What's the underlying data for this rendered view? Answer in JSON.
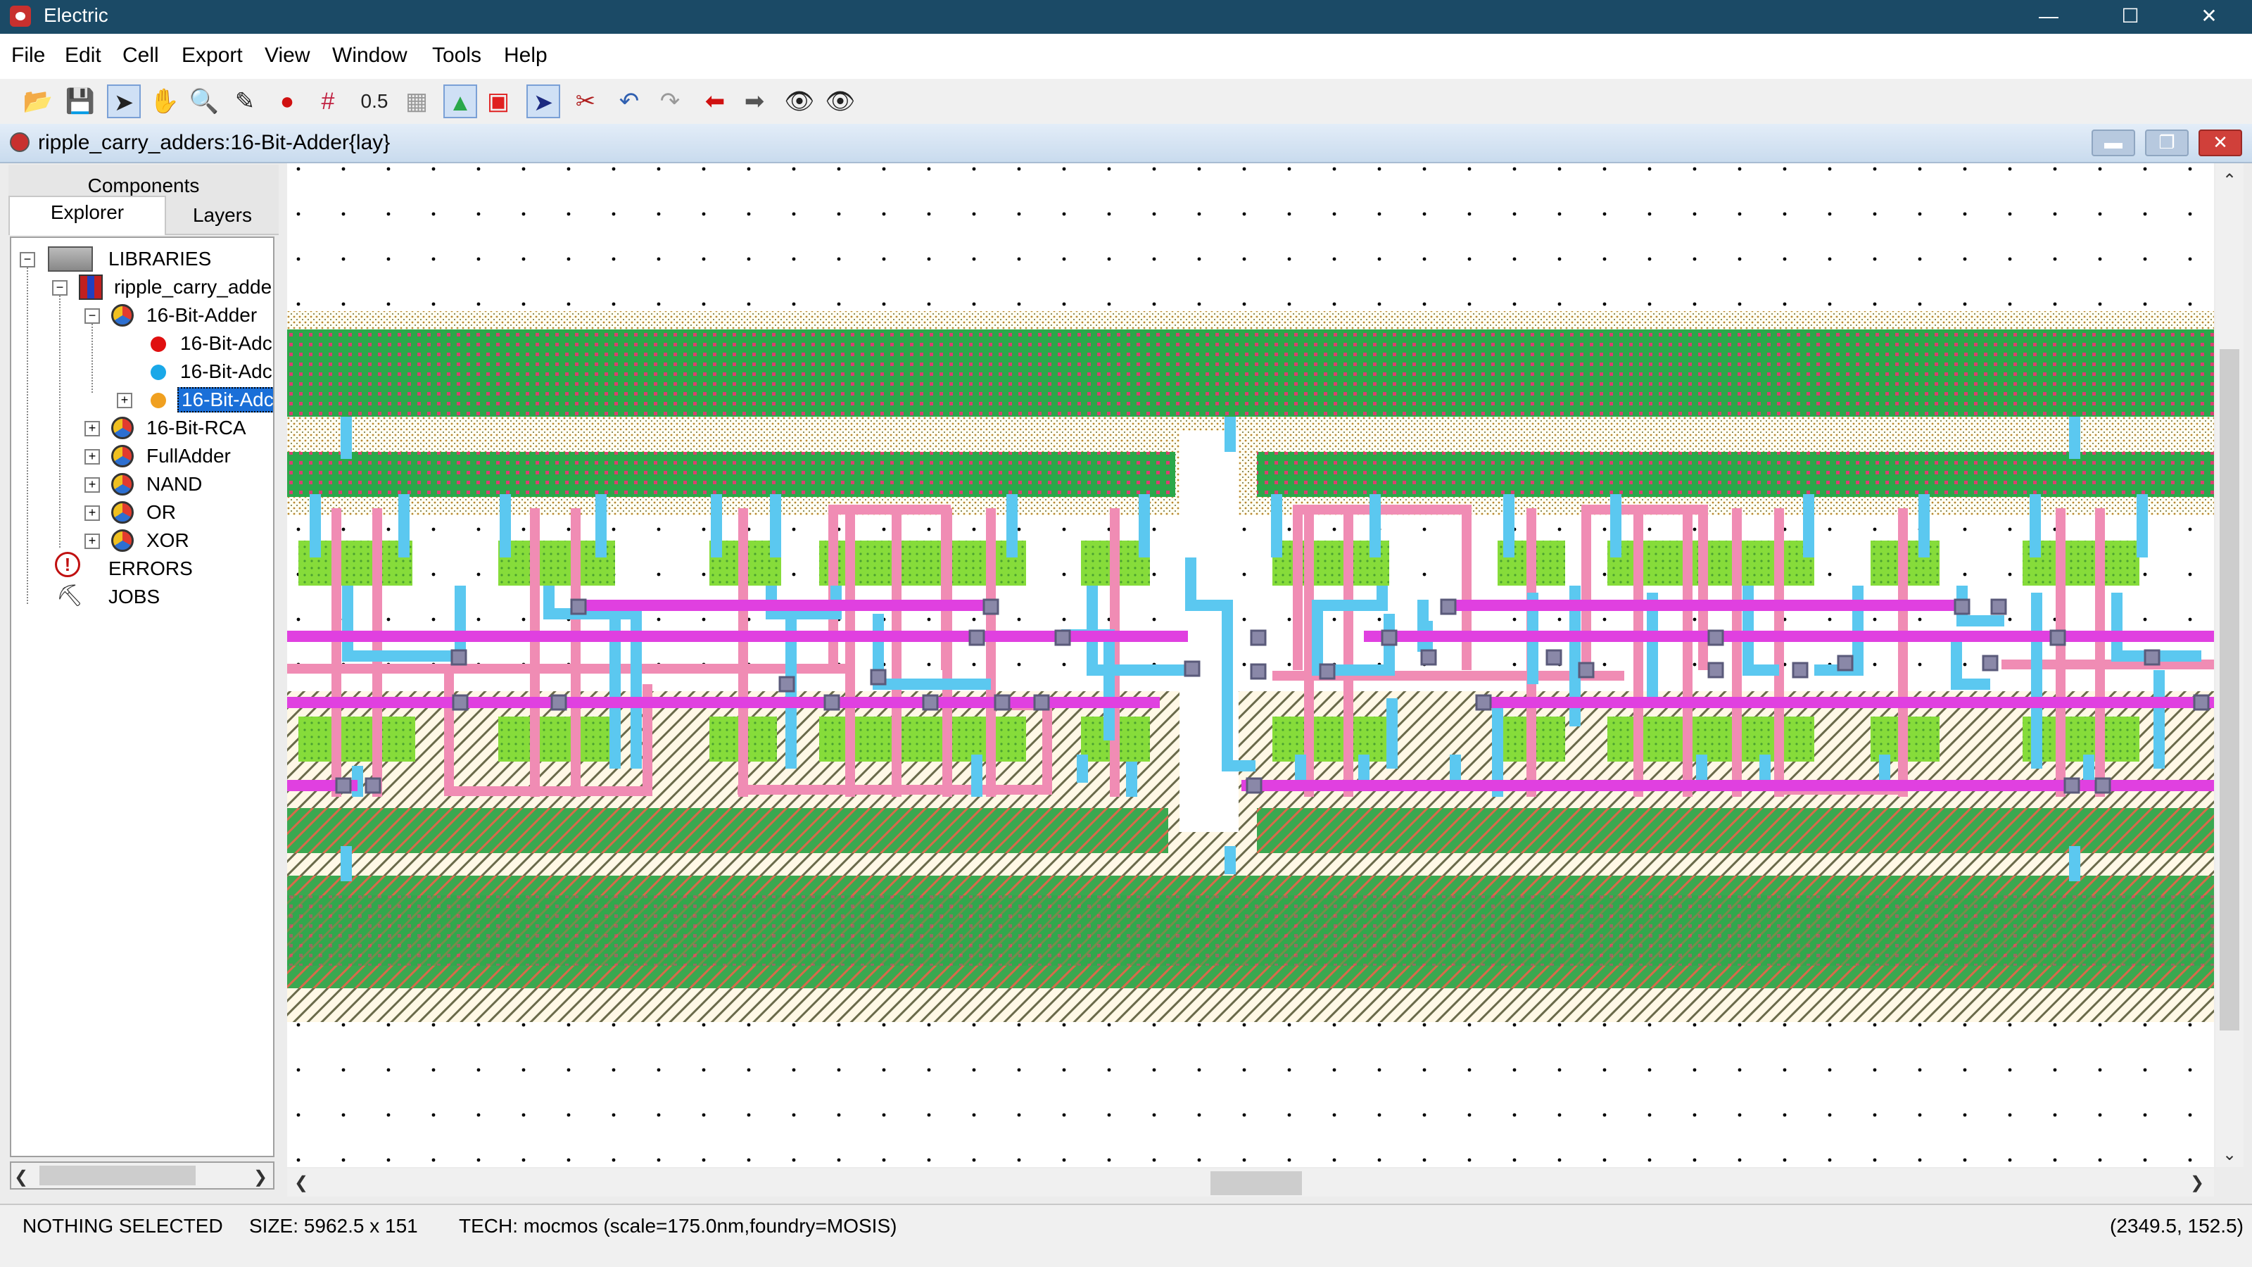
{
  "window": {
    "title": "Electric",
    "minimize_icon": "minimize-icon",
    "maximize_icon": "maximize-icon",
    "close_icon": "close-icon"
  },
  "menu": [
    "File",
    "Edit",
    "Cell",
    "Export",
    "View",
    "Window",
    "Tools",
    "Help"
  ],
  "toolbar": {
    "scale_label": "0.5"
  },
  "frame": {
    "title": "ripple_carry_adders:16-Bit-Adder{lay}"
  },
  "panel": {
    "tabs": {
      "components": "Components",
      "explorer": "Explorer",
      "layers": "Layers"
    },
    "tree": {
      "libraries": "LIBRARIES",
      "library": "ripple_carry_adde",
      "cell_open": "16-Bit-Adder",
      "views": [
        "16-Bit-Adc",
        "16-Bit-Adc",
        "16-Bit-Adc"
      ],
      "cells": [
        "16-Bit-RCA",
        "FullAdder",
        "NAND",
        "OR",
        "XOR"
      ],
      "errors": "ERRORS",
      "jobs": "JOBS"
    }
  },
  "status": {
    "selection": "NOTHING SELECTED",
    "size": "SIZE: 5962.5 x 151",
    "tech": "TECH: mocmos (scale=175.0nm,foundry=MOSIS)",
    "coords": "(2349.5, 152.5)"
  },
  "colors": {
    "metal1": "#5bc8f0",
    "metal2": "#e040e0",
    "poly": "#f08cb4",
    "diffusion": "#2aa84a",
    "active": "#8be04a",
    "well_dots": "#d8a040",
    "contact": "#7a7a9a"
  }
}
